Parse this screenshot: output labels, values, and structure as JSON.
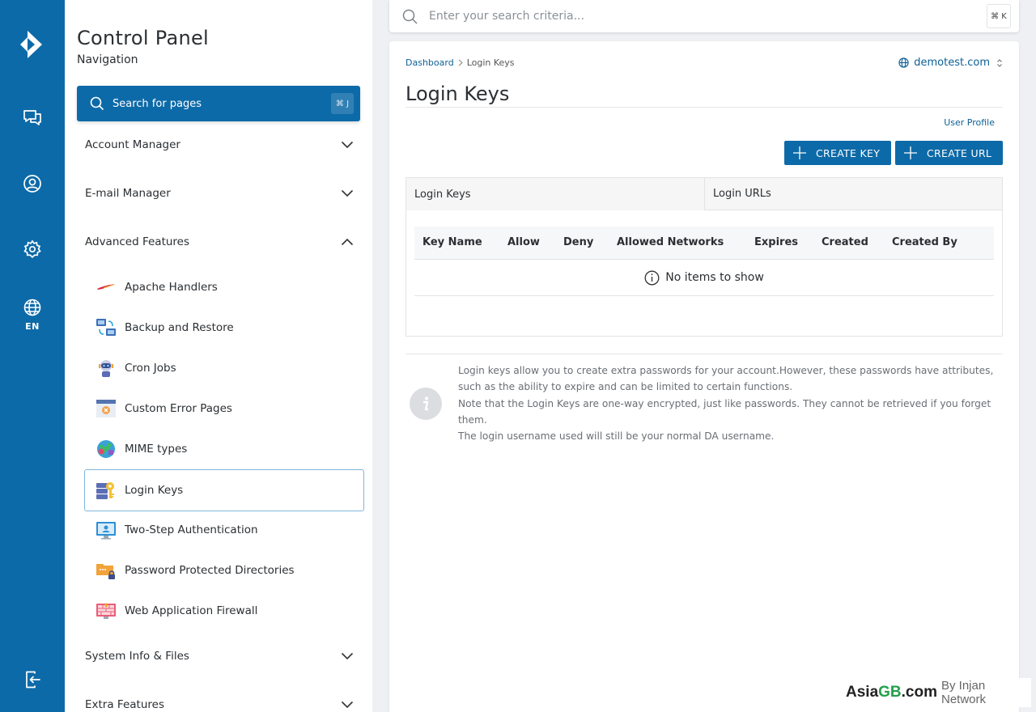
{
  "rail": {
    "language": "EN"
  },
  "nav": {
    "title": "Control Panel",
    "subtitle": "Navigation",
    "search": {
      "label": "Search for pages",
      "shortcut": "⌘ J"
    },
    "sections": [
      {
        "label": "Account Manager",
        "state": "collapsed"
      },
      {
        "label": "E-mail Manager",
        "state": "collapsed"
      },
      {
        "label": "Advanced Features",
        "state": "expanded"
      },
      {
        "label": "System Info & Files",
        "state": "collapsed"
      },
      {
        "label": "Extra Features",
        "state": "collapsed"
      }
    ],
    "items": [
      {
        "label": "Apache Handlers",
        "icon": "apache-feather-icon"
      },
      {
        "label": "Backup and Restore",
        "icon": "backup-icon"
      },
      {
        "label": "Cron Jobs",
        "icon": "robot-icon"
      },
      {
        "label": "Custom Error Pages",
        "icon": "error-page-icon"
      },
      {
        "label": "MIME types",
        "icon": "globe-puzzle-icon"
      },
      {
        "label": "Login Keys",
        "icon": "key-icon",
        "active": true
      },
      {
        "label": "Two-Step Authentication",
        "icon": "monitor-user-icon"
      },
      {
        "label": "Password Protected Directories",
        "icon": "locked-folder-icon"
      },
      {
        "label": "Web Application Firewall",
        "icon": "firewall-icon"
      }
    ]
  },
  "topbar": {
    "placeholder": "Enter your search criteria...",
    "shortcut": "⌘ K"
  },
  "main": {
    "breadcrumb": [
      "Dashboard",
      "Login Keys"
    ],
    "domain": "demotest.com",
    "title": "Login Keys",
    "profile_link": "User Profile",
    "buttons": {
      "create_key": "CREATE KEY",
      "create_url": "CREATE URL"
    },
    "tabs": [
      "Login Keys",
      "Login URLs"
    ],
    "table": {
      "columns": [
        "Key Name",
        "Allow",
        "Deny",
        "Allowed Networks",
        "Expires",
        "Created",
        "Created By"
      ],
      "empty": "No items to show"
    },
    "help": [
      "Login keys allow you to create extra passwords for your account.However, these passwords have attributes, such as the ability to expire and can be limited to certain functions.",
      "Note that the Login Keys are one-way encrypted, just like passwords. They cannot be retrieved if you forget them.",
      "The login username used will still be your normal DA username."
    ]
  },
  "watermark": {
    "brand_a": "Asia",
    "brand_b": "GB",
    "brand_c": ".com",
    "by": "By Injan Network"
  },
  "colors": {
    "primary": "#0d6aa8",
    "link": "#0d5f96",
    "active_border": "#7fb6dc"
  }
}
